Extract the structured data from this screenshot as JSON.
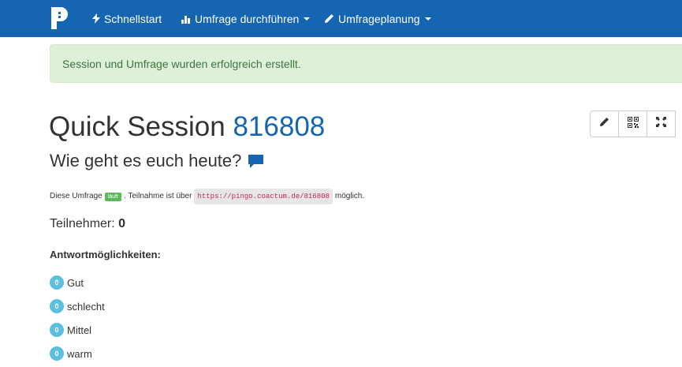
{
  "navbar": {
    "brand_icon": "pingo-logo",
    "items": [
      {
        "label": "Schnellstart",
        "icon": "bolt-icon",
        "dropdown": false
      },
      {
        "label": "Umfrage durchführen",
        "icon": "bar-chart-icon",
        "dropdown": true
      },
      {
        "label": "Umfrageplanung",
        "icon": "pencil-icon",
        "dropdown": true
      }
    ],
    "color": "#1565b0"
  },
  "alert": {
    "message": "Session und Umfrage wurden erfolgreich erstellt."
  },
  "session": {
    "title_prefix": "Quick Session",
    "number": "816808",
    "question": "Wie geht es euch heute?",
    "toolbar": [
      "pencil-icon",
      "qrcode-icon",
      "fullscreen-icon"
    ]
  },
  "status": {
    "prefix": "Diese Umfrage",
    "state_label": "läuft",
    "middle": ". Teilnahme ist über",
    "url": "https://pingo.coactum.de/816808",
    "suffix": "möglich."
  },
  "participants": {
    "label": "Teilnehmer:",
    "count": "0"
  },
  "answers": {
    "heading": "Antwortmöglichkeiten:",
    "items": [
      {
        "count": "0",
        "label": "Gut"
      },
      {
        "count": "0",
        "label": "schlecht"
      },
      {
        "count": "0",
        "label": "Mittel"
      },
      {
        "count": "0",
        "label": "warm"
      }
    ]
  }
}
